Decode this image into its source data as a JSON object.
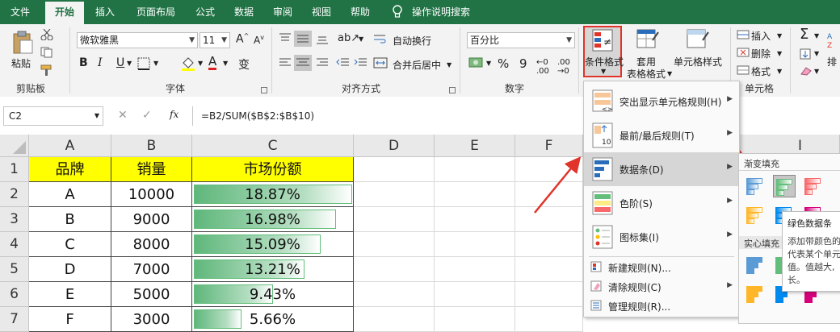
{
  "tabs": [
    "文件",
    "开始",
    "插入",
    "页面布局",
    "公式",
    "数据",
    "审阅",
    "视图",
    "帮助",
    "操作说明搜索"
  ],
  "ribbon": {
    "paste_label": "粘贴",
    "clipboard_label": "剪贴板",
    "font_name": "微软雅黑",
    "font_size": "11",
    "bold": "B",
    "italic": "I",
    "underline": "U",
    "font_color_glyph": "A",
    "font_label": "字体",
    "wrap_text": "自动换行",
    "merge_center": "合并后居中",
    "align_label": "对齐方式",
    "number_format": "百分比",
    "percent": "%",
    "comma": "9",
    "number_label": "数字",
    "cond_format_line1": "条件格式",
    "table_format_line1": "套用",
    "table_format_line2": "表格格式",
    "cell_style": "单元格样式",
    "insert": "插入",
    "delete": "删除",
    "format": "格式",
    "cells_label": "单元格",
    "sort_partial": "排"
  },
  "formula_bar": {
    "name_box": "C2",
    "fx": "fx",
    "formula": "=B2/SUM($B$2:$B$10)"
  },
  "columns": [
    "A",
    "B",
    "C",
    "D",
    "E",
    "F",
    "I"
  ],
  "rows": [
    "1",
    "2",
    "3",
    "4",
    "5",
    "6",
    "7"
  ],
  "table": {
    "headers": [
      "品牌",
      "销量",
      "市场份额"
    ],
    "data": [
      {
        "brand": "A",
        "sales": "10000",
        "share": "18.87%",
        "fraction": 0.1887
      },
      {
        "brand": "B",
        "sales": "9000",
        "share": "16.98%",
        "fraction": 0.1698
      },
      {
        "brand": "C",
        "sales": "8000",
        "share": "15.09%",
        "fraction": 0.1509
      },
      {
        "brand": "D",
        "sales": "7000",
        "share": "13.21%",
        "fraction": 0.1321
      },
      {
        "brand": "E",
        "sales": "5000",
        "share": "9.43%",
        "fraction": 0.0943
      },
      {
        "brand": "F",
        "sales": "3000",
        "share": "5.66%",
        "fraction": 0.0566
      }
    ]
  },
  "cond_menu": {
    "items": [
      {
        "label": "突出显示单元格规则(H)"
      },
      {
        "label": "最前/最后规则(T)"
      },
      {
        "label": "数据条(D)"
      },
      {
        "label": "色阶(S)"
      },
      {
        "label": "图标集(I)"
      }
    ],
    "small_items": [
      {
        "label": "新建规则(N)..."
      },
      {
        "label": "清除规则(C)"
      },
      {
        "label": "管理规则(R)..."
      }
    ],
    "icon_text_10": "10"
  },
  "submenu": {
    "gradient_title": "渐变填充",
    "solid_title": "实心填充"
  },
  "tooltip": {
    "title": "绿色数据条",
    "line1": "添加带颜色的",
    "line2": "代表某个单元",
    "line3": "值。值越大,",
    "line4": "长。"
  },
  "colors": {
    "excel_green": "#217346",
    "highlight_red": "#e0342a",
    "header_yellow": "#ffff00",
    "bar_green": "#63be7b"
  }
}
